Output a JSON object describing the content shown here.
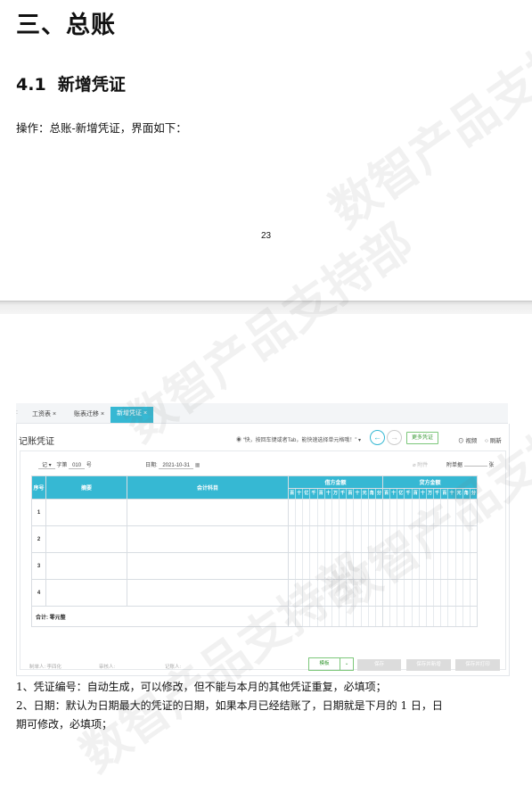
{
  "doc": {
    "h1": "三、总账",
    "h2_num": "4.1",
    "h2_text": "新增凭证",
    "intro": "操作：总账-新增凭证，界面如下：",
    "page_number": "23",
    "watermark": "数智产品支持部",
    "items": [
      "1、凭证编号：自动生成，可以修改，但不能与本月的其他凭证重复，必填项；",
      "2、日期：默认为日期最大的凭证的日期，如果本月已经结账了，日期就是下月的 1 日，日",
      "期可修改，必填项；"
    ]
  },
  "ui": {
    "tabs": [
      {
        "label": "工资表",
        "close": "×"
      },
      {
        "label": "账表迁移",
        "close": "×"
      },
      {
        "label": "新增凭证",
        "close": "×"
      }
    ],
    "title": "记账凭证",
    "hint": "“快，按回车键或者Tab，能快速选择单元格哦！”",
    "more_btn": "更多凭证",
    "view": "视频",
    "refresh": "刷新",
    "voucher_word": "记",
    "no_prefix": "字第",
    "voucher_no": "010",
    "no_suffix": "号",
    "date_label": "日期:",
    "date_value": "2021-10-31",
    "attach": "附件",
    "attach_count_label": "附单据",
    "attach_unit": "张",
    "cols": {
      "seq": "序号",
      "summary": "摘要",
      "account": "会计科目",
      "debit": "借方金额",
      "credit": "贷方金额"
    },
    "digits": [
      "百",
      "十",
      "亿",
      "千",
      "百",
      "十",
      "万",
      "千",
      "百",
      "十",
      "元",
      "角",
      "分"
    ],
    "rows": [
      "1",
      "2",
      "3",
      "4"
    ],
    "total_label": "合计:",
    "total_value": "零元整",
    "footer": {
      "maker": "制单人: 李四化",
      "reviewer": "审核人:",
      "poster": "记账人:"
    },
    "buttons": {
      "template": "模板",
      "save": "保存",
      "save_new": "保存并新增",
      "save_print": "保存并打印"
    }
  },
  "colors": {
    "accent": "#36b8d3",
    "green": "#3a9b37"
  }
}
